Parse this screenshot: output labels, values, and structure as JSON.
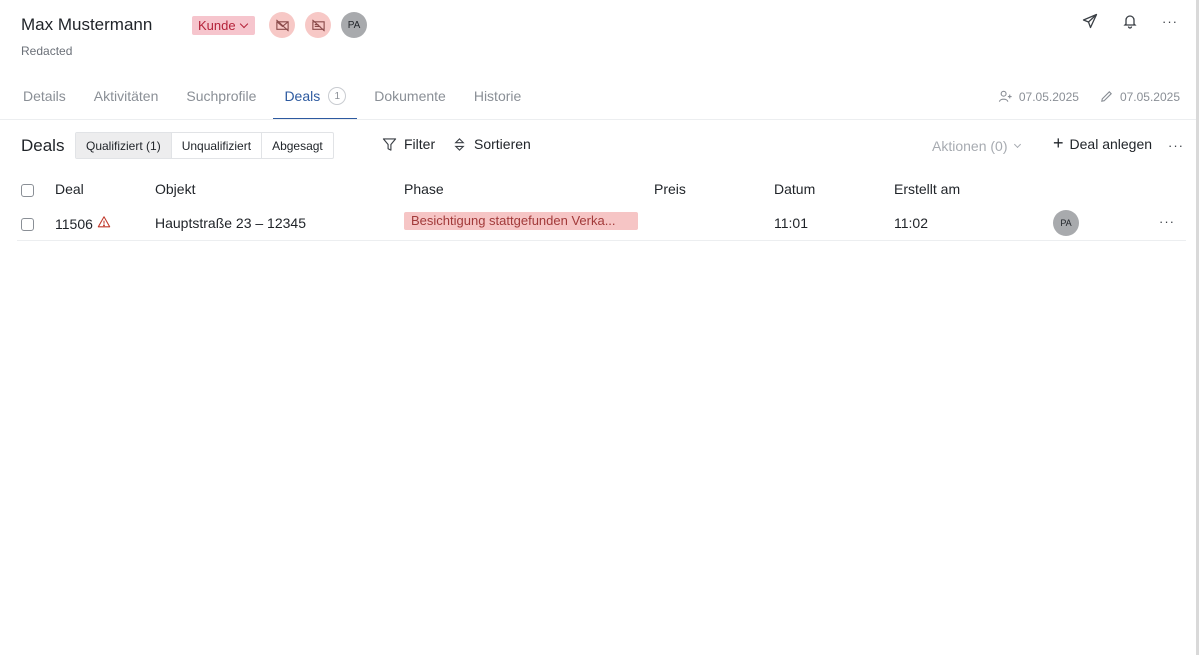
{
  "header": {
    "name": "Max Mustermann",
    "subtitle": "Redacted",
    "type_badge": "Kunde",
    "avatar_initials": "PA"
  },
  "tabs": [
    {
      "label": "Details"
    },
    {
      "label": "Aktivitäten"
    },
    {
      "label": "Suchprofile"
    },
    {
      "label": "Deals",
      "count": "1",
      "active": true
    },
    {
      "label": "Dokumente"
    },
    {
      "label": "Historie"
    }
  ],
  "meta": {
    "created_date": "07.05.2025",
    "edited_date": "07.05.2025"
  },
  "toolbar": {
    "section_title": "Deals",
    "segments": [
      "Qualifiziert (1)",
      "Unqualifiziert",
      "Abgesagt"
    ],
    "filter_label": "Filter",
    "sort_label": "Sortieren",
    "actions_label": "Aktionen (0)",
    "add_label": "Deal anlegen"
  },
  "table": {
    "columns": [
      "Deal",
      "Objekt",
      "Phase",
      "Preis",
      "Datum",
      "Erstellt am"
    ],
    "rows": [
      {
        "deal": "11506",
        "objekt": "Hauptstraße 23 – 12345",
        "phase": "Besichtigung stattgefunden Verka...",
        "preis": "",
        "datum": "11:01",
        "erstellt": "11:02",
        "avatar": "PA"
      }
    ]
  },
  "colors": {
    "accent": "#2d5aa0",
    "badge_bg": "#f6c5cd",
    "badge_text": "#b4233a",
    "warning": "#c0392b"
  },
  "icons": [
    "chevron-down-icon",
    "no-email-icon",
    "no-mail-icon",
    "send-icon",
    "bell-icon",
    "more-icon",
    "add-user-icon",
    "pencil-icon",
    "filter-icon",
    "sort-icon",
    "plus-icon",
    "warning-icon"
  ]
}
